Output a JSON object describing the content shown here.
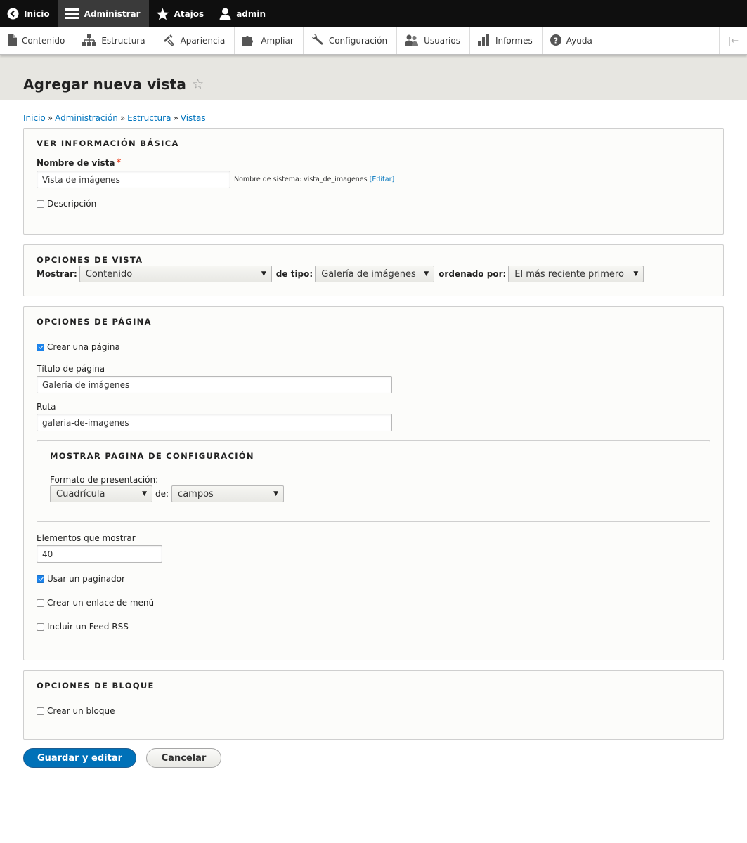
{
  "toolbar": {
    "home_label": "Inicio",
    "manage_label": "Administrar",
    "shortcuts_label": "Atajos",
    "user_label": "admin"
  },
  "tray": {
    "items": [
      "Contenido",
      "Estructura",
      "Apariencia",
      "Ampliar",
      "Configuración",
      "Usuarios",
      "Informes",
      "Ayuda"
    ],
    "toggle_icon": "|←"
  },
  "page": {
    "title": "Agregar nueva vista",
    "star": "☆"
  },
  "breadcrumb": {
    "items": [
      "Inicio",
      "Administración",
      "Estructura",
      "Vistas"
    ],
    "separator": "»"
  },
  "basic": {
    "legend": "VER INFORMACIÓN BÁSICA",
    "name_label": "Nombre de vista",
    "required_mark": "*",
    "name_value": "Vista de imágenes",
    "machine_prefix": "Nombre de sistema: vista_de_imagenes",
    "machine_edit": "[Editar]",
    "description_label": "Descripción"
  },
  "view_options": {
    "legend": "OPCIONES DE VISTA",
    "show_label": "Mostrar:",
    "show_value": "Contenido",
    "type_label": "de tipo:",
    "type_value": "Galería de imágenes",
    "sort_label": "ordenado por:",
    "sort_value": "El más reciente primero"
  },
  "page_options": {
    "legend": "OPCIONES DE PÁGINA",
    "create_page_label": "Crear una página",
    "create_page_checked": true,
    "title_label": "Título de página",
    "title_value": "Galería de imágenes",
    "path_label": "Ruta",
    "path_value": "galeria-de-imagenes",
    "display_settings": {
      "legend": "MOSTRAR PAGINA DE CONFIGURACIÓN",
      "format_label": "Formato de presentación:",
      "format_value": "Cuadrícula",
      "of_label": "de:",
      "of_value": "campos"
    },
    "items_label": "Elementos que mostrar",
    "items_value": "40",
    "pager_label": "Usar un paginador",
    "pager_checked": true,
    "menu_link_label": "Crear un enlace de menú",
    "menu_link_checked": false,
    "rss_label": "Incluir un Feed RSS",
    "rss_checked": false
  },
  "block_options": {
    "legend": "OPCIONES DE BLOQUE",
    "create_block_label": "Crear un bloque",
    "create_block_checked": false
  },
  "actions": {
    "save_label": "Guardar y editar",
    "cancel_label": "Cancelar"
  },
  "colors": {
    "toolbar_bg": "#0f0f0f",
    "link": "#0074bd",
    "primary_button": "#0071b8",
    "checkbox_checked": "#1b83ec",
    "header_bg": "#e7e6e1"
  }
}
